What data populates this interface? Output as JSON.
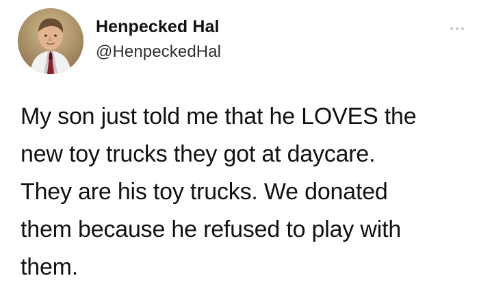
{
  "tweet": {
    "author": {
      "display_name": "Henpecked Hal",
      "handle": "@HenpeckedHal",
      "avatar_icon": "profile-photo"
    },
    "more_icon": "more-options-icon",
    "text": "My son just told me that he LOVES the\nnew toy trucks they got at daycare.\nThey are his toy trucks. We donated\nthem because he refused to play with\nthem."
  },
  "colors": {
    "background": "#ffffff",
    "text": "#111111",
    "handle": "#2e2e2e",
    "icon": "#c8c8c8"
  }
}
